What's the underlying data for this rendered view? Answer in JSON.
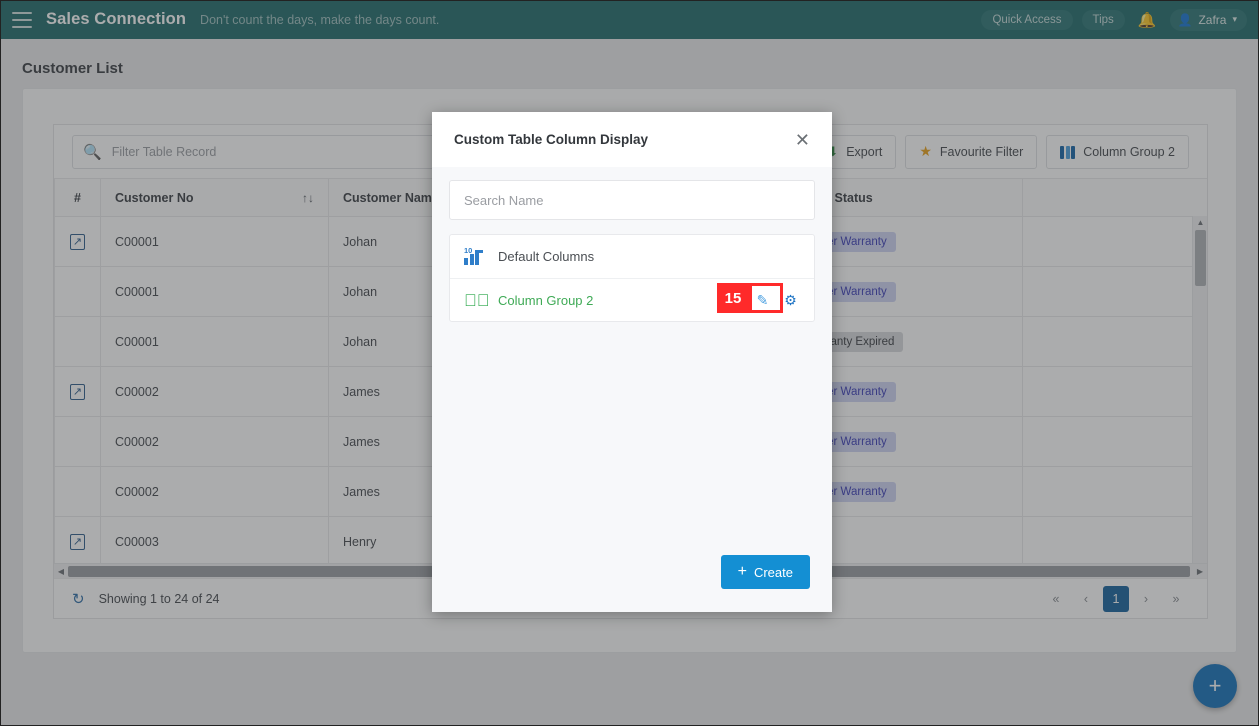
{
  "topbar": {
    "menu_icon": "hamburger-icon",
    "brand": "Sales Connection",
    "tagline": "Don't count the days, make the days count.",
    "quick_access": "Quick Access",
    "tips": "Tips",
    "bell_icon": "bell-icon",
    "user_name": "Zafra",
    "caret": "∨",
    "bg_color": "#226b6b"
  },
  "page": {
    "title": "Customer List"
  },
  "toolbar": {
    "search_placeholder": "Filter Table Record",
    "search_value": "",
    "export_label": "Export",
    "favourite_filter_label": "Favourite Filter",
    "column_group_label": "Column Group 2"
  },
  "table": {
    "columns": [
      "#",
      "Customer No",
      "Customer Name",
      "",
      "Asset Status"
    ],
    "sort_icon": "↑↓",
    "rows": [
      {
        "open": true,
        "customer_no": "C00001",
        "customer_name": "Johan",
        "extra": "",
        "asset_status": "Under Warranty",
        "status_type": "warranty"
      },
      {
        "open": false,
        "customer_no": "C00001",
        "customer_name": "Johan",
        "extra": "",
        "asset_status": "Under Warranty",
        "status_type": "warranty"
      },
      {
        "open": false,
        "customer_no": "C00001",
        "customer_name": "Johan",
        "extra": "",
        "asset_status": "Warranty Expired",
        "status_type": "expired"
      },
      {
        "open": true,
        "customer_no": "C00002",
        "customer_name": "James",
        "extra": "",
        "asset_status": "Under Warranty",
        "status_type": "warranty"
      },
      {
        "open": false,
        "customer_no": "C00002",
        "customer_name": "James",
        "extra": "",
        "asset_status": "Under Warranty",
        "status_type": "warranty"
      },
      {
        "open": false,
        "customer_no": "C00002",
        "customer_name": "James",
        "extra": "",
        "asset_status": "Under Warranty",
        "status_type": "warranty"
      },
      {
        "open": true,
        "customer_no": "C00003",
        "customer_name": "Henry",
        "extra": "",
        "asset_status": "-",
        "status_type": "none"
      }
    ]
  },
  "footer": {
    "refresh_icon": "refresh-icon",
    "showing": "Showing 1 to 24 of 24",
    "pager": {
      "first": "«",
      "prev": "‹",
      "current": "1",
      "next": "›",
      "last": "»"
    }
  },
  "fab": {
    "label": "+"
  },
  "modal": {
    "title": "Custom Table Column Display",
    "close_icon": "close-icon",
    "search_placeholder": "Search Name",
    "search_value": "",
    "items": [
      {
        "label": "Default Columns",
        "icon": "bar-chart-10-icon",
        "selected": false,
        "count_badge": "10",
        "has_actions": false
      },
      {
        "label": "Column Group 2",
        "icon": "check-circle-icon",
        "selected": true,
        "has_actions": true,
        "edit_icon": "pencil-icon",
        "settings_icon": "gear-icon"
      }
    ],
    "create_label": "Create",
    "create_plus": "+"
  },
  "annotation": {
    "step_number": "15",
    "color": "#ff2a2a"
  }
}
